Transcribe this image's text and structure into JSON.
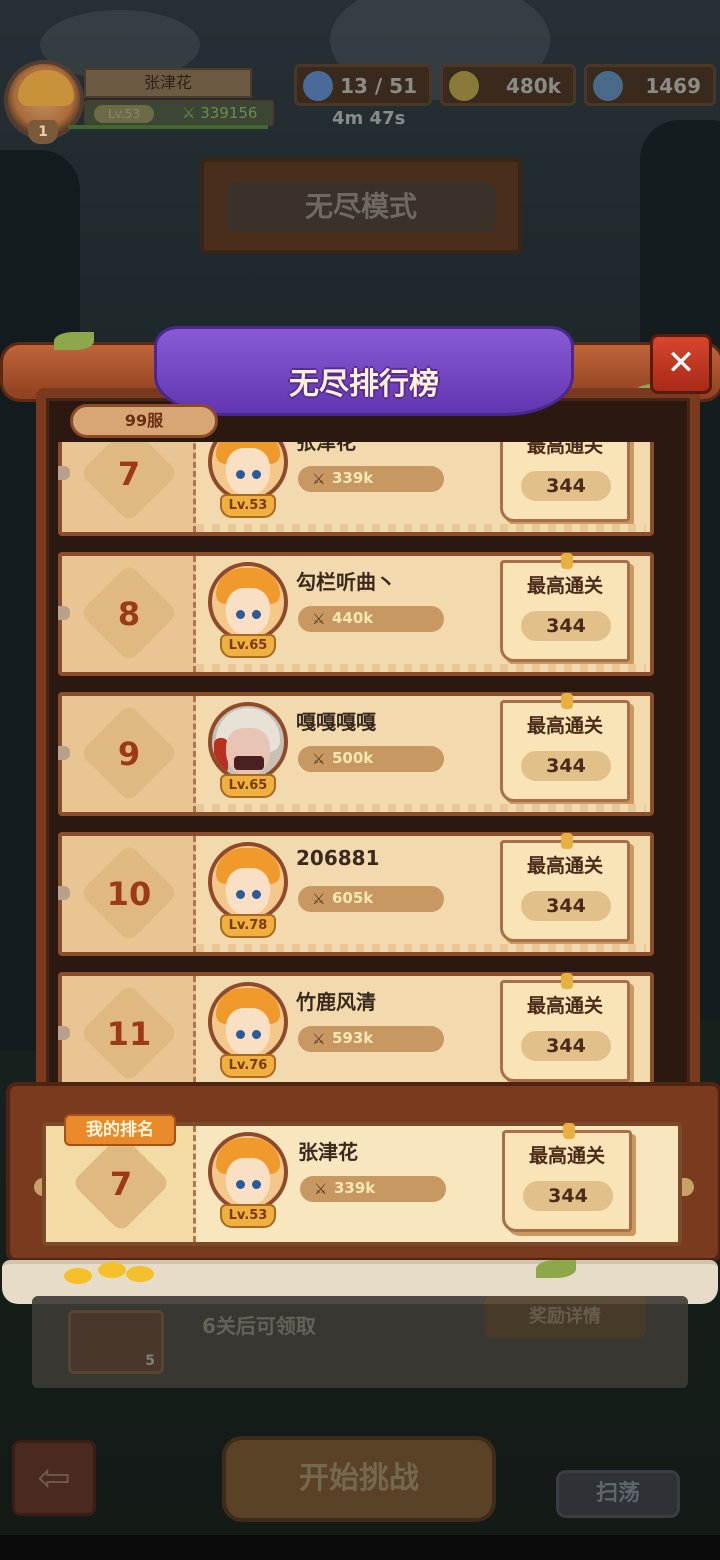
{
  "player": {
    "name": "张津花",
    "level": "Lv.53",
    "power": "339156",
    "vip": "1"
  },
  "resources": {
    "stamina": "13 / 51",
    "stamina_timer": "4m 47s",
    "gold": "480k",
    "gems": "1469"
  },
  "mode_title": "无尽模式",
  "leaderboard": {
    "title": "无尽排行榜",
    "server": "99服",
    "close_icon": "✕",
    "rows": [
      {
        "rank": "7",
        "name": "张津花",
        "level": "Lv.53",
        "power": "339k",
        "label": "最高通关",
        "score": "344",
        "avatar": "orange-hair-hero"
      },
      {
        "rank": "8",
        "name": "勾栏听曲丶",
        "level": "Lv.65",
        "power": "440k",
        "label": "最高通关",
        "score": "344",
        "avatar": "orange-hair-hero"
      },
      {
        "rank": "9",
        "name": "嘎嘎嘎嘎",
        "level": "Lv.65",
        "power": "500k",
        "label": "最高通关",
        "score": "344",
        "avatar": "hooded-hero"
      },
      {
        "rank": "10",
        "name": "206881",
        "level": "Lv.78",
        "power": "605k",
        "label": "最高通关",
        "score": "344",
        "avatar": "orange-hair-hero"
      },
      {
        "rank": "11",
        "name": "竹鹿风清",
        "level": "Lv.76",
        "power": "593k",
        "label": "最高通关",
        "score": "344",
        "avatar": "orange-hair-hero"
      }
    ],
    "my_rank": {
      "label": "我的排名",
      "rank": "7",
      "name": "张津花",
      "level": "Lv.53",
      "power": "339k",
      "score_label": "最高通关",
      "score": "344"
    }
  },
  "reward": {
    "text": "6关后可领取",
    "button": "奖励详情",
    "count": "5"
  },
  "bottom": {
    "back_icon": "⇦",
    "start": "开始挑战",
    "sweep": "扫荡"
  },
  "colors": {
    "rank_text": "#9c3a18",
    "banner_purple": "#6a3cc0",
    "power_text": "#f6e8b4",
    "close_red": "#c43a22"
  }
}
